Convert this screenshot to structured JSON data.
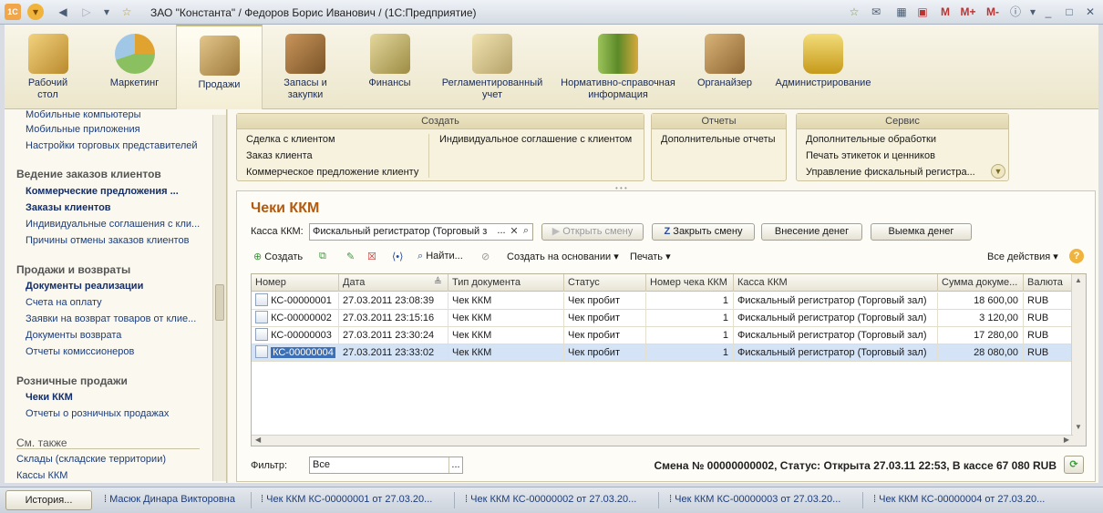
{
  "window": {
    "title": "ЗАО \"Константа\" / Федоров Борис Иванович /  (1С:Предприятие)",
    "toolbar_right": [
      "M",
      "M+",
      "M-"
    ]
  },
  "sections": [
    {
      "label1": "Рабочий",
      "label2": "стол",
      "icon": "desk-icon",
      "color": "#e0b54b"
    },
    {
      "label1": "Маркетинг",
      "label2": "",
      "icon": "pie-chart-icon",
      "color": "#8cc063"
    },
    {
      "label1": "Продажи",
      "label2": "",
      "icon": "truck-icon",
      "color": "#c8a45d"
    },
    {
      "label1": "Запасы и",
      "label2": "закупки",
      "icon": "boxes-icon",
      "color": "#b7864a"
    },
    {
      "label1": "Финансы",
      "label2": "",
      "icon": "coins-icon",
      "color": "#cdbd78"
    },
    {
      "label1": "Регламентированный",
      "label2": "учет",
      "icon": "documents-icon",
      "color": "#d7c78e"
    },
    {
      "label1": "Нормативно-справочная",
      "label2": "информация",
      "icon": "binders-icon",
      "color": "#7fa34a"
    },
    {
      "label1": "Органайзер",
      "label2": "",
      "icon": "clipboard-icon",
      "color": "#b88f53"
    },
    {
      "label1": "Администрирование",
      "label2": "",
      "icon": "database-icon",
      "color": "#e5c24a"
    }
  ],
  "nav": {
    "cut_item": "Мобильные компьютеры",
    "items_top": [
      "Мобильные приложения",
      "Настройки торговых представителей"
    ],
    "group1": "Ведение заказов клиентов",
    "group1_items": [
      "Коммерческие предложения ...",
      "Заказы клиентов",
      "Индивидуальные соглашения с кли...",
      "Причины отмены заказов клиентов"
    ],
    "group2": "Продажи и возвраты",
    "group2_items": [
      "Документы реализации",
      "Счета на оплату",
      "Заявки на возврат товаров от клие...",
      "Документы возврата",
      "Отчеты комиссионеров"
    ],
    "group3": "Розничные продажи",
    "group3_items": [
      "Чеки ККМ",
      "Отчеты о розничных продажах"
    ],
    "see_also": "См. также",
    "see_also_items": [
      "Склады (складские территории)",
      "Кассы ККМ"
    ]
  },
  "panel": {
    "create_title": "Создать",
    "create_links": [
      "Сделка с клиентом",
      "Заказ клиента",
      "Коммерческое предложение клиенту",
      "Индивидуальное соглашение с клиентом"
    ],
    "reports_title": "Отчеты",
    "reports_links": [
      "Дополнительные отчеты"
    ],
    "service_title": "Сервис",
    "service_links": [
      "Дополнительные обработки",
      "Печать этикеток и ценников",
      "Управление фискальный регистра..."
    ]
  },
  "form": {
    "title": "Чеки ККМ",
    "kassa_label": "Касса ККМ:",
    "kassa_value": "Фискальный регистратор (Торговый з",
    "open_shift": "Открыть смену",
    "close_shift": "Закрыть смену",
    "deposit": "Внесение денег",
    "withdraw": "Выемка денег",
    "toolbar": {
      "create": "Создать",
      "find": "Найти...",
      "create_based": "Создать на основании",
      "print": "Печать",
      "all_actions": "Все действия"
    },
    "columns": [
      "Номер",
      "Дата",
      "Тип документа",
      "Статус",
      "Номер чека ККМ",
      "Касса ККМ",
      "Сумма докуме...",
      "Валюта"
    ],
    "rows": [
      [
        "КС-00000001",
        "27.03.2011 23:08:39",
        "Чек ККМ",
        "Чек пробит",
        "1",
        "Фискальный регистратор (Торговый зал)",
        "18 600,00",
        "RUB"
      ],
      [
        "КС-00000002",
        "27.03.2011 23:15:16",
        "Чек ККМ",
        "Чек пробит",
        "1",
        "Фискальный регистратор (Торговый зал)",
        "3 120,00",
        "RUB"
      ],
      [
        "КС-00000003",
        "27.03.2011 23:30:24",
        "Чек ККМ",
        "Чек пробит",
        "1",
        "Фискальный регистратор (Торговый зал)",
        "17 280,00",
        "RUB"
      ],
      [
        "КС-00000004",
        "27.03.2011 23:33:02",
        "Чек ККМ",
        "Чек пробит",
        "1",
        "Фискальный регистратор (Торговый зал)",
        "28 080,00",
        "RUB"
      ]
    ],
    "filter_label": "Фильтр:",
    "filter_value": "Все",
    "status": "Смена № 00000000002, Статус: Открыта 27.03.11 22:53, В кассе 67 080 RUB"
  },
  "taskbar": {
    "history": "История...",
    "items": [
      "Масюк Динара Викторовна",
      "Чек ККМ КС-00000001 от 27.03.20...",
      "Чек ККМ КС-00000002 от 27.03.20...",
      "Чек ККМ КС-00000003 от 27.03.20...",
      "Чек ККМ КС-00000004 от 27.03.20..."
    ]
  }
}
